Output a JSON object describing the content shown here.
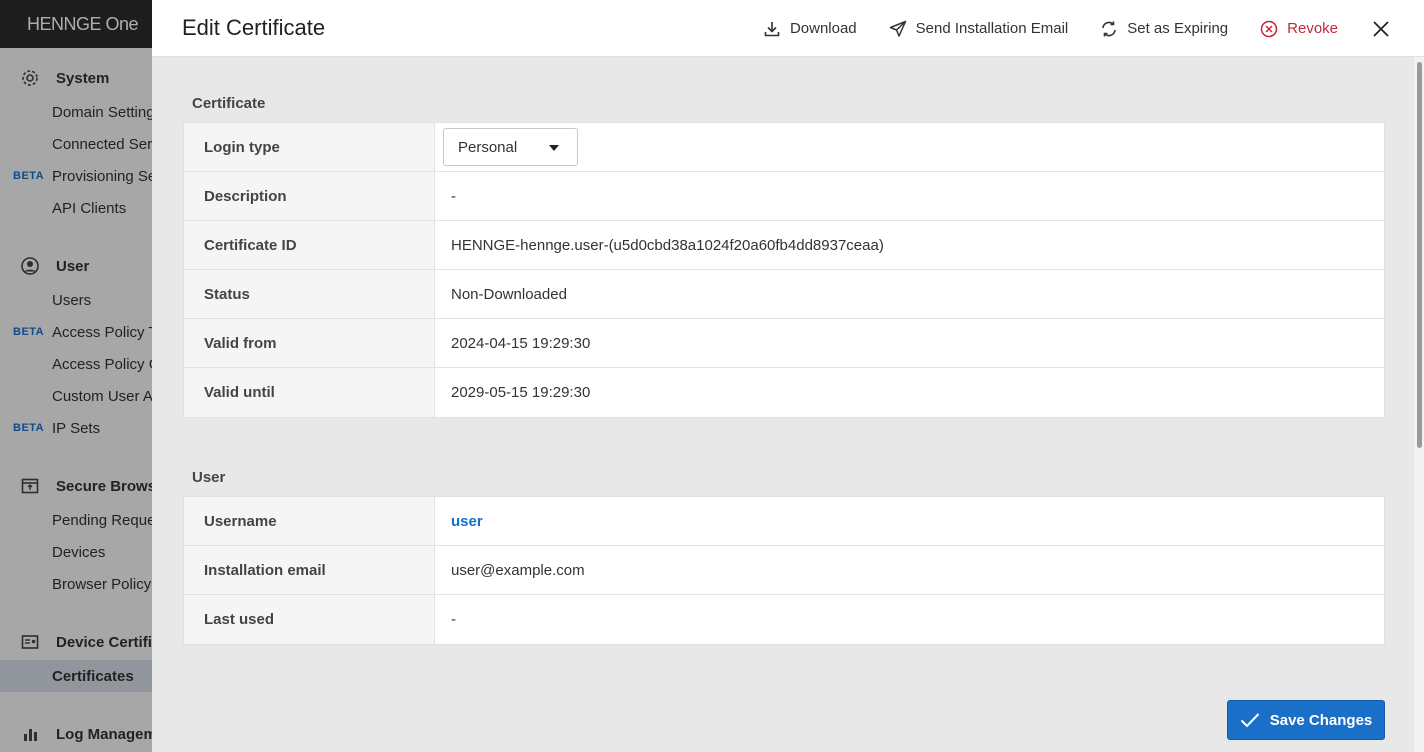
{
  "sidebar": {
    "brand": "HENNGE One",
    "sections": [
      {
        "label": "System",
        "icon": "gear-icon"
      },
      {
        "label": "User",
        "icon": "user-circle-icon"
      },
      {
        "label": "Secure Browser",
        "icon": "browser-window-icon"
      },
      {
        "label": "Device Certificates",
        "icon": "certificate-card-icon"
      },
      {
        "label": "Log Management",
        "icon": "bar-chart-icon"
      }
    ],
    "items": [
      {
        "label": "Domain Settings",
        "beta": ""
      },
      {
        "label": "Connected Services",
        "beta": ""
      },
      {
        "label": "Provisioning Services",
        "beta": "BETA"
      },
      {
        "label": "API Clients",
        "beta": ""
      },
      {
        "label": "Users",
        "beta": ""
      },
      {
        "label": "Access Policy Templates",
        "beta": "BETA"
      },
      {
        "label": "Access Policy Groups",
        "beta": ""
      },
      {
        "label": "Custom User Attributes",
        "beta": ""
      },
      {
        "label": "IP Sets",
        "beta": "BETA"
      },
      {
        "label": "Pending Requests",
        "beta": ""
      },
      {
        "label": "Devices",
        "beta": ""
      },
      {
        "label": "Browser Policy",
        "beta": ""
      },
      {
        "label": "Certificates",
        "beta": ""
      }
    ]
  },
  "modal": {
    "title": "Edit Certificate",
    "actions": {
      "download": "Download",
      "send_email": "Send Installation Email",
      "set_expiring": "Set as Expiring",
      "revoke": "Revoke"
    },
    "certificate_section": {
      "title": "Certificate",
      "login_type_label": "Login type",
      "login_type_value": "Personal",
      "rows": [
        {
          "key": "Description",
          "value": "-"
        },
        {
          "key": "Certificate ID",
          "value": "HENNGE-hennge.user-(u5d0cbd38a1024f20a60fb4dd8937ceaa)"
        },
        {
          "key": "Status",
          "value": "Non-Downloaded"
        },
        {
          "key": "Valid from",
          "value": "2024-04-15 19:29:30"
        },
        {
          "key": "Valid until",
          "value": "2029-05-15 19:29:30"
        }
      ]
    },
    "user_section": {
      "title": "User",
      "username_label": "Username",
      "username_value": "user",
      "rows": [
        {
          "key": "Installation email",
          "value": "user@example.com"
        },
        {
          "key": "Last used",
          "value": "-"
        }
      ]
    },
    "save_label": "Save Changes"
  },
  "colors": {
    "accent": "#1a6fc8",
    "danger": "#c4283a"
  }
}
